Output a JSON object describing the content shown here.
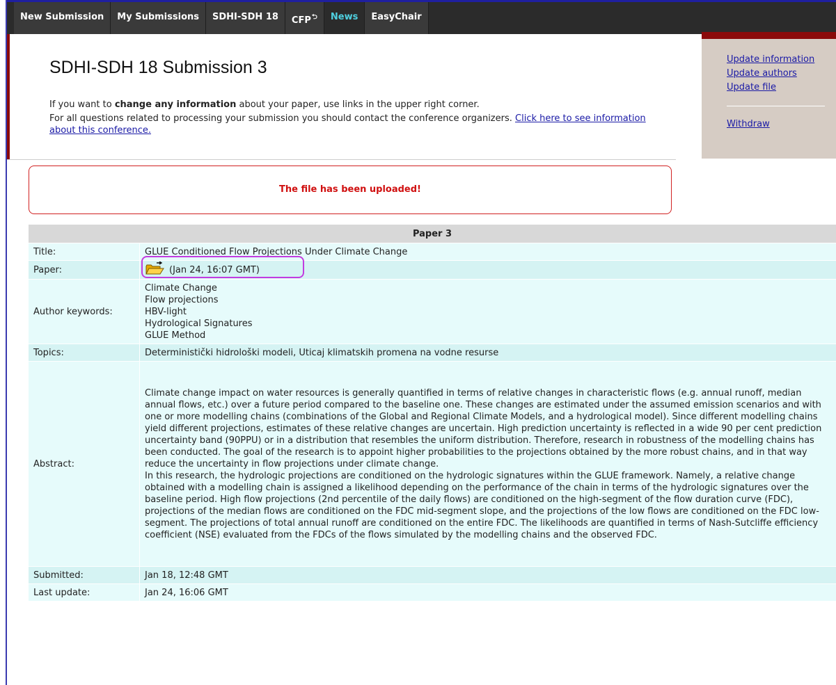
{
  "nav": {
    "tabs": [
      "New Submission",
      "My Submissions",
      "SDHI-SDH 18",
      "CFP",
      "News",
      "EasyChair"
    ]
  },
  "side_menu": {
    "update_information": "Update information",
    "update_authors": "Update authors",
    "update_file": "Update file",
    "withdraw": "Withdraw"
  },
  "header": {
    "title": "SDHI-SDH 18 Submission 3",
    "intro_prefix": "If you want to ",
    "intro_bold": "change any information",
    "intro_suffix": " about your paper, use links in the upper right corner.",
    "contact_text": "For all questions related to processing your submission you should contact the conference organizers. ",
    "contact_link": "Click here to see information about this conference."
  },
  "message": "The file has been uploaded!",
  "paper": {
    "heading": "Paper 3",
    "title_label": "Title:",
    "title_value": "GLUE Conditioned Flow Projections Under Climate Change",
    "paper_label": "Paper:",
    "paper_value": "(Jan 24, 16:07 GMT)",
    "keywords_label": "Author keywords:",
    "keywords": [
      "Climate Change",
      "Flow projections",
      "HBV-light",
      "Hydrological Signatures",
      "GLUE Method"
    ],
    "topics_label": "Topics:",
    "topics_value": "Deterministički hidrološki modeli, Uticaj klimatskih promena na vodne resurse",
    "abstract_label": "Abstract:",
    "abstract_p1": "Climate change impact on water resources is generally quantified in terms of relative changes in characteristic flows (e.g. annual runoff, median annual flows, etc.) over a future period compared to the baseline one. These changes are estimated under the assumed emission scenarios and with one or more modelling chains (combinations of the Global and Regional Climate Models, and a hydrological model). Since different modelling chains yield different projections, estimates of these relative changes are uncertain. High prediction uncertainty is reflected in a wide 90 per cent prediction uncertainty band (90PPU) or in a distribution that resembles the uniform distribution. Therefore, research in robustness of the modelling chains has been conducted. The goal of the research is to appoint higher probabilities to the projections obtained by the more robust chains, and in that way reduce the uncertainty in flow projections under climate change.",
    "abstract_p2": "In this research, the hydrologic projections are conditioned on the hydrologic signatures within the GLUE framework. Namely, a relative change obtained with a modelling chain is assigned a likelihood depending on the performance of the chain in terms of the hydrologic signatures over the baseline period. High flow projections (2nd percentile of the daily flows) are conditioned on the high-segment of the flow duration curve (FDC), projections of the median flows are conditioned on the FDC mid-segment slope, and the projections of the low flows are conditioned on the FDC low-segment. The projections of total annual runoff are conditioned on the entire FDC. The likelihoods are quantified in terms of Nash-Sutcliffe efficiency coefficient (NSE) evaluated from the FDCs of the flows simulated by the modelling chains and the observed FDC.",
    "submitted_label": "Submitted:",
    "submitted_value": "Jan 18, 12:48 GMT",
    "updated_label": "Last update:",
    "updated_value": "Jan 24, 16:06 GMT"
  },
  "colors": {
    "accent_maroon": "#8b0a0a",
    "link": "#1a1aa6",
    "message_red": "#d01010",
    "highlight_purple": "#c23ce0"
  },
  "icons": [
    "folder-open-icon",
    "cfp-return-icon"
  ]
}
